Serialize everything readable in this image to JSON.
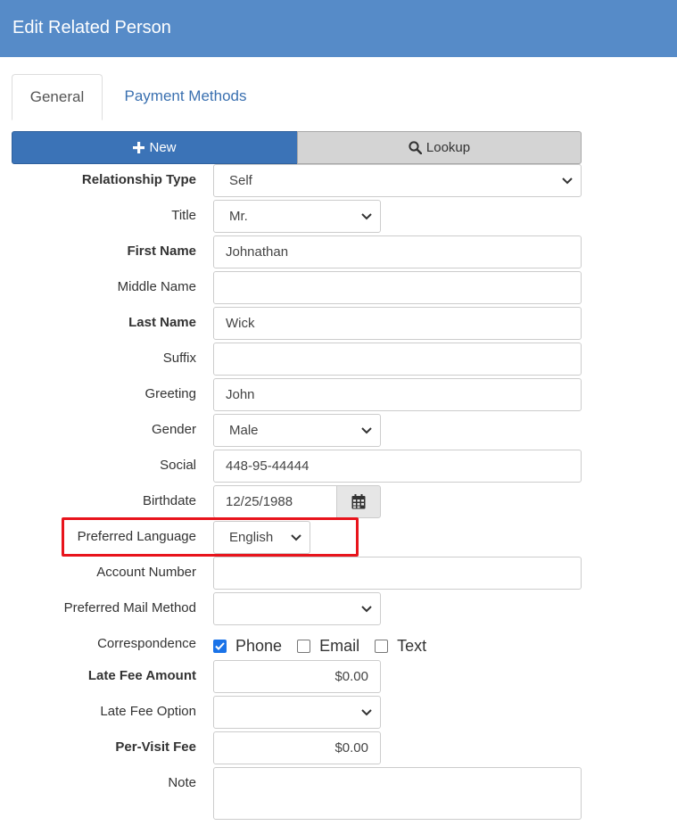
{
  "header": {
    "title": "Edit Related Person"
  },
  "tabs": [
    {
      "label": "General",
      "active": true
    },
    {
      "label": "Payment Methods",
      "active": false
    }
  ],
  "actions": {
    "new_label": "New",
    "lookup_label": "Lookup"
  },
  "form": {
    "relationship_type": {
      "label": "Relationship Type",
      "value": "Self"
    },
    "title": {
      "label": "Title",
      "value": "Mr."
    },
    "first_name": {
      "label": "First Name",
      "value": "Johnathan"
    },
    "middle_name": {
      "label": "Middle Name",
      "value": ""
    },
    "last_name": {
      "label": "Last Name",
      "value": "Wick"
    },
    "suffix": {
      "label": "Suffix",
      "value": ""
    },
    "greeting": {
      "label": "Greeting",
      "value": "John"
    },
    "gender": {
      "label": "Gender",
      "value": "Male"
    },
    "social": {
      "label": "Social",
      "value": "448-95-44444"
    },
    "birthdate": {
      "label": "Birthdate",
      "value": "12/25/1988"
    },
    "preferred_language": {
      "label": "Preferred Language",
      "value": "English"
    },
    "account_number": {
      "label": "Account Number",
      "value": ""
    },
    "preferred_mail_method": {
      "label": "Preferred Mail Method",
      "value": ""
    },
    "correspondence": {
      "label": "Correspondence",
      "options": [
        {
          "label": "Phone",
          "checked": true
        },
        {
          "label": "Email",
          "checked": false
        },
        {
          "label": "Text",
          "checked": false
        }
      ]
    },
    "late_fee_amount": {
      "label": "Late Fee Amount",
      "value": "$0.00"
    },
    "late_fee_option": {
      "label": "Late Fee Option",
      "value": ""
    },
    "per_visit_fee": {
      "label": "Per-Visit Fee",
      "value": "$0.00"
    },
    "note": {
      "label": "Note",
      "value": ""
    }
  },
  "icons": {
    "new": "plus-icon",
    "lookup": "search-icon",
    "birthdate": "calendar-icon",
    "select": "chevron-down-icon"
  },
  "colors": {
    "header": "#568bc8",
    "primary": "#3b73b7",
    "highlight": "#e8141c",
    "link": "#3a70b0"
  }
}
